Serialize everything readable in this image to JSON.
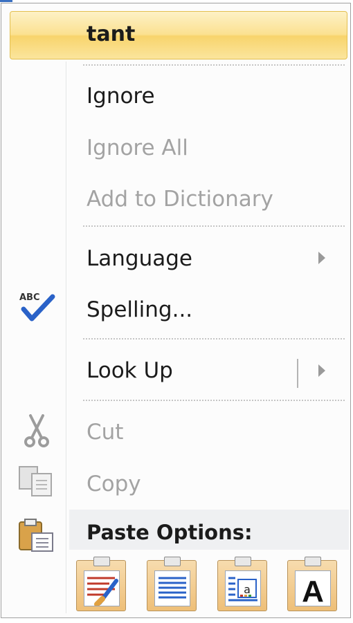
{
  "menu": {
    "suggestion": "tant",
    "items": {
      "ignore": "Ignore",
      "ignore_all": "Ignore All",
      "add_to_dictionary": "Add to Dictionary",
      "language": "Language",
      "spelling": "Spelling...",
      "look_up": "Look Up",
      "cut": "Cut",
      "copy": "Copy",
      "paste_options": "Paste Options:"
    },
    "paste_buttons": [
      {
        "icon": "keep-source-formatting-icon"
      },
      {
        "icon": "merge-formatting-icon"
      },
      {
        "icon": "picture-paste-icon",
        "glyph": "a"
      },
      {
        "icon": "keep-text-only-icon",
        "glyph": "A"
      }
    ],
    "spelling_icon_text": "ABC"
  },
  "colors": {
    "highlight_border": "#e3bf4f",
    "highlight_fill": "#fbe191",
    "disabled_text": "#a3a3a3",
    "check_blue": "#2a62c8"
  }
}
